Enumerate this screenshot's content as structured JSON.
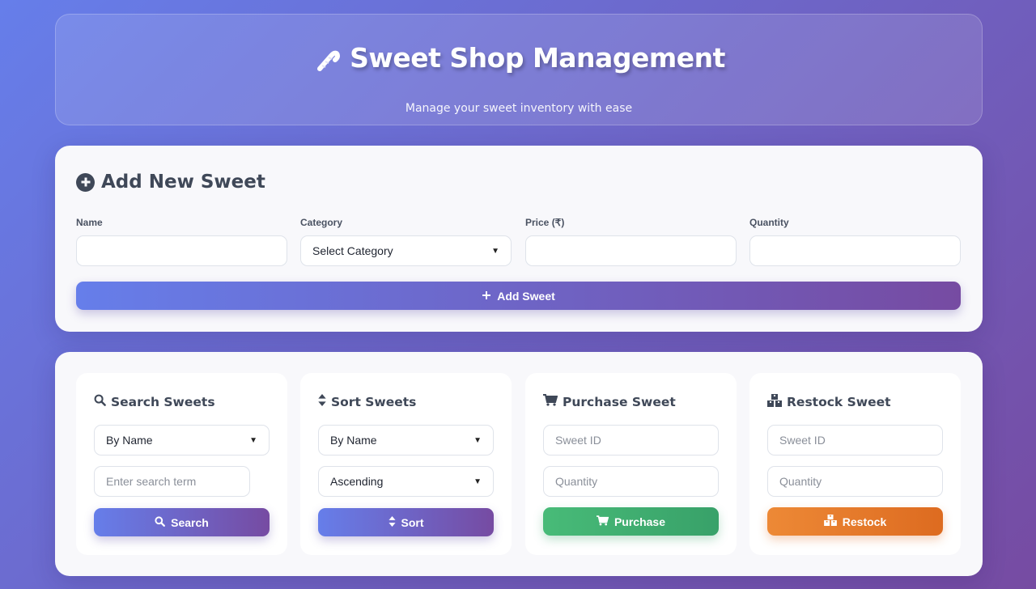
{
  "header": {
    "title": "Sweet Shop Management",
    "subtitle": "Manage your sweet inventory with ease"
  },
  "add_form": {
    "title": "Add New Sweet",
    "fields": {
      "name": {
        "label": "Name",
        "value": ""
      },
      "category": {
        "label": "Category",
        "selected": "Select Category"
      },
      "price": {
        "label": "Price (₹)",
        "value": ""
      },
      "quantity": {
        "label": "Quantity",
        "value": ""
      }
    },
    "submit_label": "Add Sweet"
  },
  "panels": {
    "search": {
      "title": "Search Sweets",
      "by_selected": "By Name",
      "term_placeholder": "Enter search term",
      "button_label": "Search"
    },
    "sort": {
      "title": "Sort Sweets",
      "by_selected": "By Name",
      "order_selected": "Ascending",
      "button_label": "Sort"
    },
    "purchase": {
      "title": "Purchase Sweet",
      "id_placeholder": "Sweet ID",
      "qty_placeholder": "Quantity",
      "button_label": "Purchase"
    },
    "restock": {
      "title": "Restock Sweet",
      "id_placeholder": "Sweet ID",
      "qty_placeholder": "Quantity",
      "button_label": "Restock"
    }
  },
  "icons": {
    "header": "candy-cane-icon",
    "add_title": "plus-circle-icon",
    "add_button": "plus-icon",
    "search": "search-icon",
    "sort": "sort-icon",
    "purchase": "cart-icon",
    "restock": "boxes-icon"
  },
  "colors": {
    "gradient_start": "#667eea",
    "gradient_end": "#764ba2",
    "purchase_green": "#48bb78",
    "restock_orange": "#ed8936",
    "title_text": "#3f4858"
  }
}
